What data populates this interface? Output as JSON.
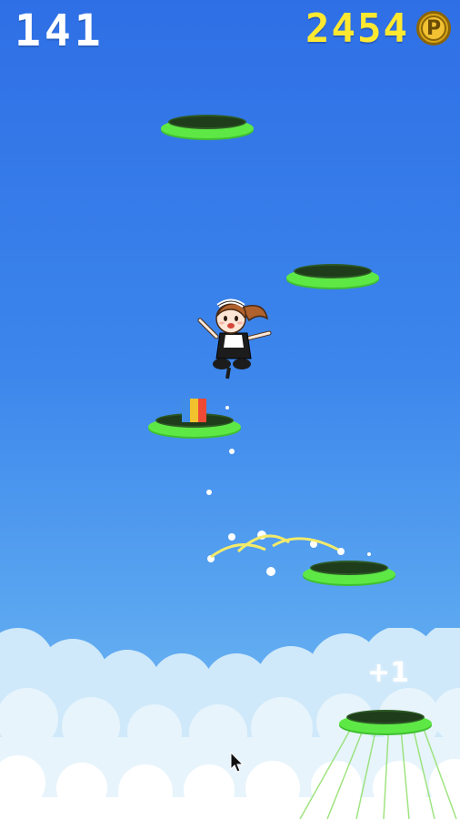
{
  "hud": {
    "score": "141",
    "coins": "2454",
    "coin_symbol": "P"
  },
  "popup": {
    "score_gain": "+1"
  },
  "colors": {
    "sky_top": "#2f6fe6",
    "platform_rim": "#5ee846",
    "platform_hole": "#1f3d1a",
    "coin_text": "#ffe930",
    "score_text": "#ffffff"
  },
  "icons": [
    "coin-icon",
    "mouse-cursor-icon",
    "rainbow-block-icon",
    "maid-girl-character",
    "sparkle-icon"
  ]
}
